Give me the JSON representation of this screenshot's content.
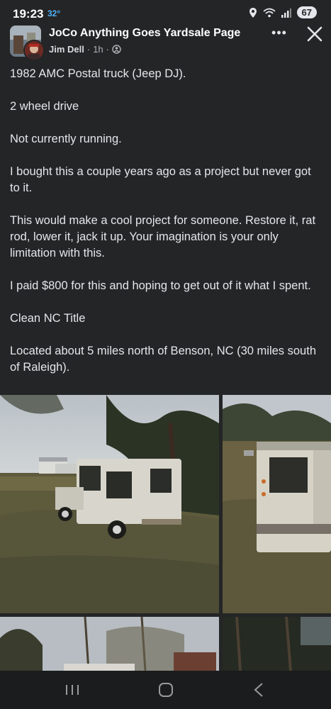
{
  "status": {
    "time": "19:23",
    "temperature": "32°",
    "battery": "67",
    "icons": [
      "location-icon",
      "wifi-icon",
      "signal-icon",
      "battery-icon"
    ]
  },
  "header": {
    "group_name": "JoCo Anything Goes Yardsale  Page",
    "author": "Jim Dell",
    "time": "1h",
    "privacy_icon": "group-privacy-icon",
    "more_label": "•••",
    "close_icon": "close-icon"
  },
  "post": {
    "paragraphs": [
      "1982 AMC Postal truck (Jeep DJ).",
      "2 wheel drive",
      "Not currently running.",
      "I bought this a couple years ago as a project but never got to it.",
      "This would make a cool project for someone. Restore it, rat rod, lower it, jack it up. Your imagination is your only limitation with this.",
      "I paid $800 for this and hoping to get out of it what I spent.",
      "Clean NC Title",
      "Located about 5 miles north of Benson, NC (30 miles south of Raleigh)."
    ]
  },
  "photos": [
    {
      "name": "postal-jeep-side-photo"
    },
    {
      "name": "postal-jeep-rear-photo"
    },
    {
      "name": "trees-yard-photo"
    },
    {
      "name": "dark-trees-photo"
    }
  ],
  "nav": {
    "icons": [
      "recent-apps-icon",
      "home-icon",
      "back-icon"
    ]
  },
  "colors": {
    "background": "#242526",
    "text": "#e4e6eb",
    "secondary_text": "#b0b3b8",
    "temp_blue": "#4fb3f6"
  }
}
